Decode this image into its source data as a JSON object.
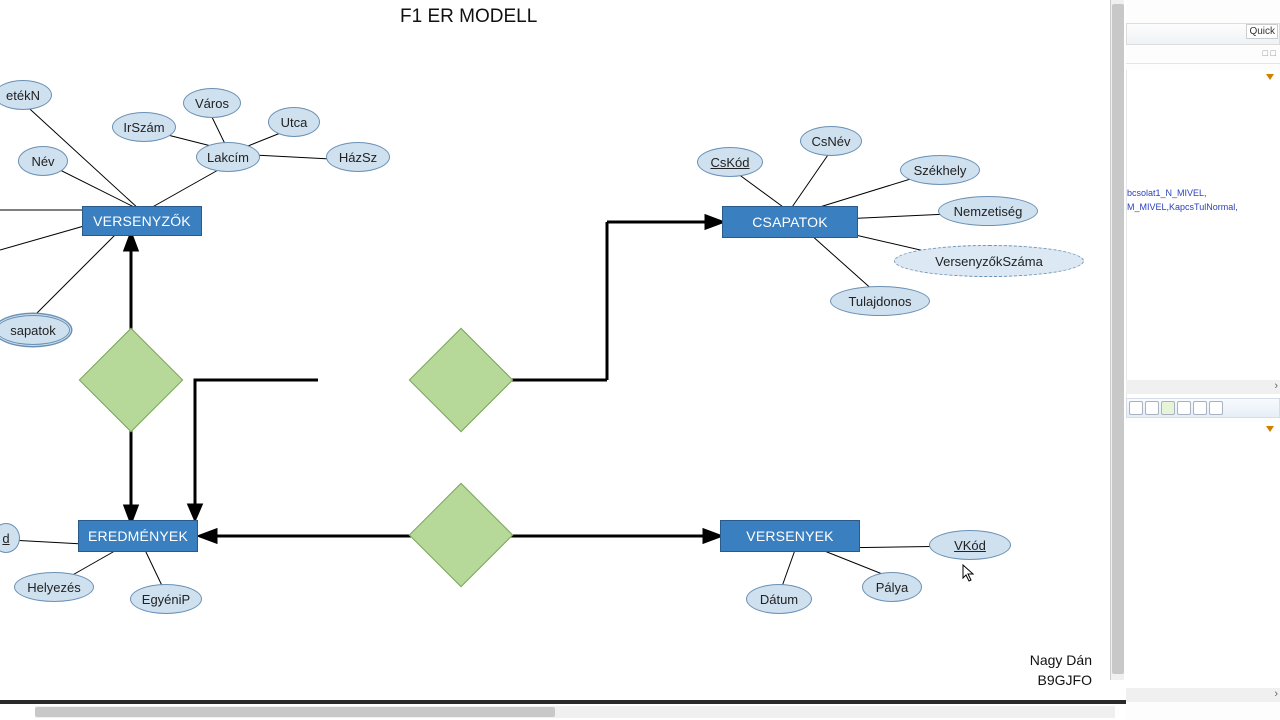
{
  "title": "F1 ER MODELL",
  "entities": {
    "versenyzok": "VERSENYZŐK",
    "csapatok": "CSAPATOK",
    "eredmenyek": "EREDMÉNYEK",
    "versenyek": "VERSENYEK"
  },
  "attrs": {
    "etekN": "etékN",
    "nev": "Név",
    "irSzam": "IrSzám",
    "varos": "Város",
    "lakcim": "Lakcím",
    "utca": "Utca",
    "hazSz": "HázSz",
    "sapatok": "sapatok",
    "csKod": "CsKód",
    "csNev": "CsNév",
    "szekhely": "Székhely",
    "nemzetiseg": "Nemzetiség",
    "versenyzokSzama": "VersenyzőkSzáma",
    "tulajdonos": "Tulajdonos",
    "d_trunc": "d",
    "helyezes": "Helyezés",
    "egyeniP": "EgyéniP",
    "datum": "Dátum",
    "palya": "Pálya",
    "vkod": "VKód"
  },
  "side": {
    "quick": "Quick",
    "code1": "bcsolat1_N_MIVEL,",
    "code2": "M_MIVEL,KapcsTulNormal,"
  },
  "footer": {
    "line1": "Nagy Dán",
    "line2": "B9GJFO"
  }
}
